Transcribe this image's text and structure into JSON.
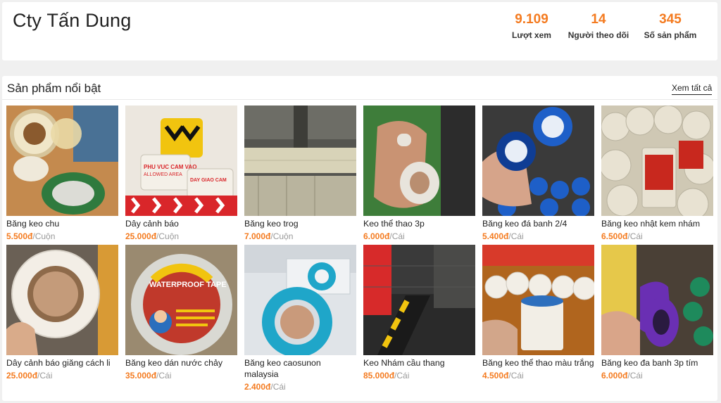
{
  "shop": {
    "name": "Cty Tấn Dung",
    "stats": [
      {
        "value": "9.109",
        "label": "Lượt xem"
      },
      {
        "value": "14",
        "label": "Người theo dõi"
      },
      {
        "value": "345",
        "label": "Số sản phẩm"
      }
    ]
  },
  "featured": {
    "title": "Sản phẩm nổi bật",
    "view_all": "Xem tất cả"
  },
  "products": [
    {
      "name": "Băng keo chu",
      "price": "5.500đ",
      "unit": "Cuộn",
      "image": "clear-packing-tape",
      "colors": [
        "#c48a4e",
        "#8a5a2e",
        "#2f7a3e"
      ]
    },
    {
      "name": "Dây cảnh báo",
      "price": "25.000đ",
      "unit": "Cuộn",
      "image": "warning-tape-rolls",
      "colors": [
        "#f4f0e8",
        "#d9262a",
        "#f1c40f"
      ]
    },
    {
      "name": "Băng keo trog",
      "price": "7.000đ",
      "unit": "Cuộn",
      "image": "tape-factory-rolls",
      "colors": [
        "#8c8c7a",
        "#d8d3b8",
        "#555550"
      ]
    },
    {
      "name": "Keo thể thao 3p",
      "price": "6.000đ",
      "unit": "Cái",
      "image": "sports-tape-hand",
      "colors": [
        "#3e7d3a",
        "#e8e4dc",
        "#c99373"
      ]
    },
    {
      "name": "Băng keo đá banh 2/4",
      "price": "5.400đ",
      "unit": "Cái",
      "image": "blue-electrical-tape",
      "colors": [
        "#1e5fc8",
        "#0f3d94",
        "#d6a48a"
      ]
    },
    {
      "name": "Băng keo nhật kem nhám",
      "price": "6.500đ",
      "unit": "Cái",
      "image": "masking-tape-red-label",
      "colors": [
        "#e8e2d2",
        "#c8281e",
        "#b9b3a0"
      ]
    },
    {
      "name": "Dây cảnh báo giăng cách li",
      "price": "25.000đ",
      "unit": "Cái",
      "image": "white-roll-hand",
      "colors": [
        "#f3eee6",
        "#c49b7a",
        "#8e6a4a"
      ]
    },
    {
      "name": "Băng keo dán nước chảy",
      "price": "35.000đ",
      "unit": "Cái",
      "image": "waterproof-tape",
      "colors": [
        "#c0392b",
        "#f1c40f",
        "#2a6fbd"
      ]
    },
    {
      "name": "Băng keo caosunon malaysia",
      "price": "2.400đ",
      "unit": "Cái",
      "image": "teal-ptfe-tape",
      "colors": [
        "#1fa6c9",
        "#e3e8ec",
        "#c99a7b"
      ]
    },
    {
      "name": "Keo Nhám cầu thang",
      "price": "85.000đ",
      "unit": "Cái",
      "image": "anti-slip-tape",
      "colors": [
        "#1a1a1a",
        "#d72a2a",
        "#f1c40f"
      ]
    },
    {
      "name": "Băng keo thể thao màu trắng",
      "price": "4.500đ",
      "unit": "Cái",
      "image": "white-sport-tape-stack",
      "colors": [
        "#f2eee6",
        "#b0651e",
        "#d2a68a"
      ]
    },
    {
      "name": "Băng keo đa banh 3p tím",
      "price": "6.000đ",
      "unit": "Cái",
      "image": "purple-tape",
      "colors": [
        "#6a2fb3",
        "#e6c84a",
        "#1e8a5c"
      ]
    }
  ]
}
